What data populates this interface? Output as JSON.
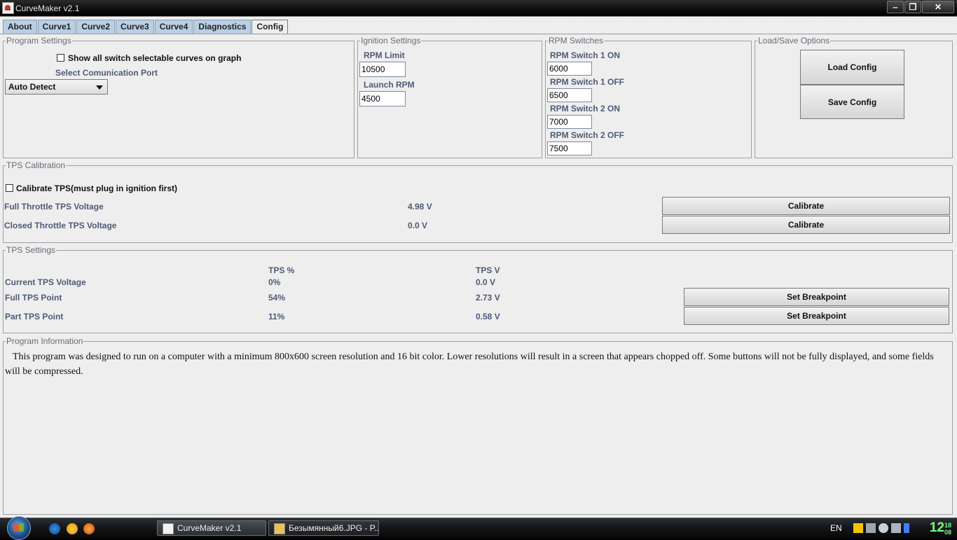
{
  "window": {
    "title": "CurveMaker v2.1",
    "minimize": "‒",
    "maximize": "❐",
    "close": "✕"
  },
  "tabs": [
    "About",
    "Curve1",
    "Curve2",
    "Curve3",
    "Curve4",
    "Diagnostics",
    "Config"
  ],
  "active_tab": "Config",
  "program_settings": {
    "legend": "Program Settings",
    "show_all_label": "Show all switch selectable curves on graph",
    "port_label": "Select Comunication Port",
    "port_value": "Auto Detect"
  },
  "ignition_settings": {
    "legend": "Ignition Settings",
    "rpm_limit_label": "RPM Limit",
    "rpm_limit_value": "10500",
    "launch_rpm_label": "Launch RPM",
    "launch_rpm_value": "4500"
  },
  "rpm_switches": {
    "legend": "RPM Switches",
    "sw1_on_label": "RPM Switch 1 ON",
    "sw1_on_value": "6000",
    "sw1_off_label": "RPM Switch 1 OFF",
    "sw1_off_value": "6500",
    "sw2_on_label": "RPM Switch 2 ON",
    "sw2_on_value": "7000",
    "sw2_off_label": "RPM Switch 2 OFF",
    "sw2_off_value": "7500"
  },
  "load_save": {
    "legend": "Load/Save Options",
    "load_label": "Load Config",
    "save_label": "Save Config"
  },
  "tps_calibration": {
    "legend": "TPS Calibration",
    "calibrate_check_label": "Calibrate TPS(must plug in ignition first)",
    "full_label": "Full Throttle TPS Voltage",
    "full_value": "4.98 V",
    "closed_label": "Closed Throttle TPS Voltage",
    "closed_value": "0.0 V",
    "calibrate_button": "Calibrate"
  },
  "tps_settings": {
    "legend": "TPS Settings",
    "col_pct": "TPS %",
    "col_v": "TPS V",
    "current_label": "Current TPS Voltage",
    "current_pct": "0%",
    "current_v": "0.0 V",
    "full_label": "Full TPS Point",
    "full_pct": "54%",
    "full_v": "2.73 V",
    "part_label": "Part TPS Point",
    "part_pct": "11%",
    "part_v": "0.58 V",
    "breakpoint_button": "Set Breakpoint"
  },
  "program_information": {
    "legend": "Program Information",
    "text": "This program was designed to run on a computer with a minimum 800x600 screen resolution and 16 bit color. Lower resolutions will result in a screen that appears chopped off. Some buttons will not be fully displayed, and some fields will be compressed."
  },
  "taskbar": {
    "tasks": [
      "CurveMaker v2.1",
      "Безымянный6.JPG - P..."
    ],
    "language": "EN",
    "clock_hour": "12",
    "clock_min": "18",
    "clock_sec": "08"
  },
  "icons": {
    "start": "windows-orb-icon",
    "quicklaunch": [
      "internet-explorer-icon",
      "aimp-icon",
      "firefox-icon"
    ],
    "tray": [
      "warning-icon",
      "network-icon",
      "speaker-icon",
      "safely-remove-icon",
      "battery-icon"
    ]
  }
}
